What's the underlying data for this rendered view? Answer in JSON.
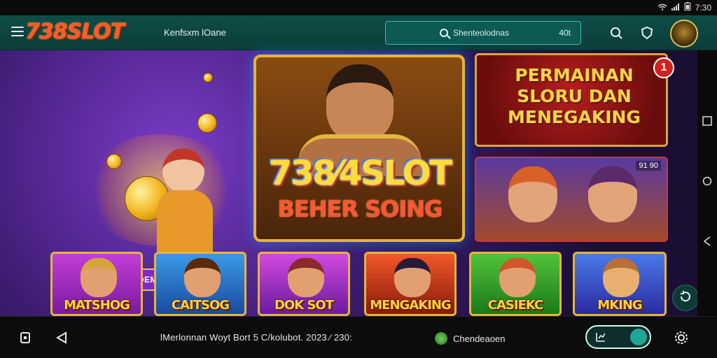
{
  "status_bar": {
    "time": "7:30",
    "icons": [
      "wifi-icon",
      "signal-icon",
      "battery-icon"
    ]
  },
  "header": {
    "brand": "738SLOT",
    "nav_label": "Kenfsxm lOane",
    "search_text": "Shenteolodnas",
    "search_count": "40t",
    "icons": [
      "search-icon",
      "shield-icon",
      "avatar"
    ]
  },
  "hero": {
    "ribbon_text": "PMSEIN DEMEECAUNK'",
    "feature_logo": "738⁄4SLOT",
    "feature_sub": "BEHER SOING"
  },
  "promo": {
    "title": "PERMAINAN SLORU DAN MENEGAKING",
    "badge": "1"
  },
  "twin_card": {
    "tag": "91 90"
  },
  "tiles": [
    {
      "label": "MATSHOG",
      "bg": "#9a2bbf"
    },
    {
      "label": "CAITSOG",
      "bg": "#2a7ad6"
    },
    {
      "label": "DOK SOT",
      "bg": "#a22ec4"
    },
    {
      "label": "MENGAKING",
      "bg": "#c8361a"
    },
    {
      "label": "CASIEKC",
      "bg": "#2fa02a"
    },
    {
      "label": "MKING",
      "bg": "#3a5ad6"
    }
  ],
  "bottom_bar": {
    "ticker": "lMerlonnan  Woyt Bort 5 C/kolubot.   2023 ⁄ 230:",
    "brand2": "Chendeaoen"
  },
  "colors": {
    "appbar": "#0f4c46",
    "accent": "#1fa596",
    "gold": "#e6b43c"
  }
}
